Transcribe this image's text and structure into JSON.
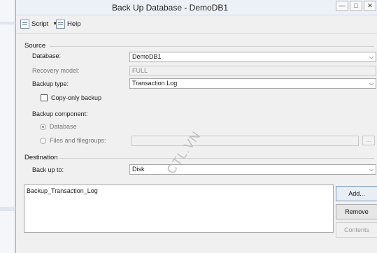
{
  "window": {
    "title": "Back Up Database - DemoDB1"
  },
  "toolbar": {
    "script_label": "Script",
    "help_label": "Help"
  },
  "source": {
    "heading": "Source",
    "database_label": "Database:",
    "database_value": "DemoDB1",
    "recovery_label": "Recovery model:",
    "recovery_value": "FULL",
    "backup_type_label": "Backup type:",
    "backup_type_value": "Transaction Log",
    "copy_only_label": "Copy-only backup",
    "component_label": "Backup component:",
    "component_database": "Database",
    "component_files": "Files and filegroups:",
    "browse_label": "..."
  },
  "destination": {
    "heading": "Destination",
    "backup_to_label": "Back up to:",
    "backup_to_value": "Disk",
    "files": [
      "Backup_Transaction_Log"
    ],
    "add_label": "Add...",
    "remove_label": "Remove",
    "contents_label": "Contents"
  },
  "watermark": "CTL.VN"
}
